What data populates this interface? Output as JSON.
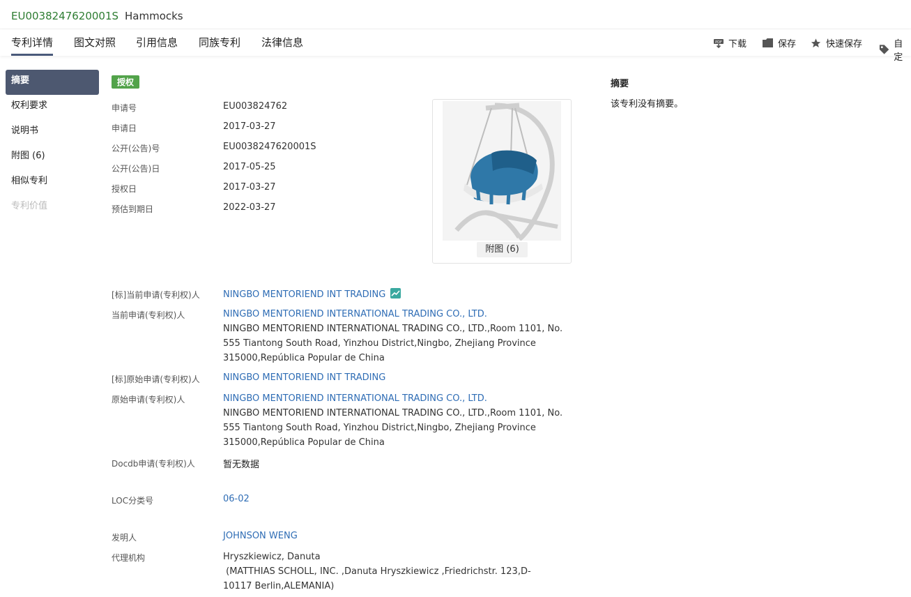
{
  "header": {
    "pub_number": "EU0038247620001S",
    "title": "Hammocks"
  },
  "tabs": [
    "专利详情",
    "图文对照",
    "引用信息",
    "同族专利",
    "法律信息"
  ],
  "toolbar": {
    "download": "下载",
    "save": "保存",
    "quick_save": "快速保存",
    "custom": "自定"
  },
  "sidebar": [
    "摘要",
    "权利要求",
    "说明书",
    "附图 (6)",
    "相似专利",
    "专利价值"
  ],
  "status_badge": "授权",
  "fields": {
    "app_no_label": "申请号",
    "app_no": "EU003824762",
    "app_date_label": "申请日",
    "app_date": "2017-03-27",
    "pub_no_label": "公开(公告)号",
    "pub_no": "EU0038247620001S",
    "pub_date_label": "公开(公告)日",
    "pub_date": "2017-05-25",
    "grant_date_label": "授权日",
    "grant_date": "2017-03-27",
    "expiry_label": "预估到期日",
    "expiry": "2022-03-27",
    "std_cur_app_label": "[标]当前申请(专利权)人",
    "std_cur_app": "NINGBO MENTORIEND INT TRADING",
    "cur_app_label": "当前申请(专利权)人",
    "cur_app": "NINGBO MENTORIEND INTERNATIONAL TRADING CO., LTD.",
    "cur_app_addr": "NINGBO MENTORIEND INTERNATIONAL TRADING CO., LTD.,Room 1101, No. 555 Tiantong South Road, Yinzhou District,Ningbo, Zhejiang Province 315000,República Popular de China",
    "std_orig_app_label": "[标]原始申请(专利权)人",
    "std_orig_app": "NINGBO MENTORIEND INT TRADING",
    "orig_app_label": "原始申请(专利权)人",
    "orig_app": "NINGBO MENTORIEND INTERNATIONAL TRADING CO., LTD.",
    "orig_app_addr": "NINGBO MENTORIEND INTERNATIONAL TRADING CO., LTD.,Room 1101, No. 555 Tiantong South Road, Yinzhou District,Ningbo, Zhejiang Province 315000,República Popular de China",
    "docdb_label": "Docdb申请(专利权)人",
    "docdb": "暂无数据",
    "loc_label": "LOC分类号",
    "loc": "06-02",
    "inventor_label": "发明人",
    "inventor": "JOHNSON WENG",
    "agency_label": "代理机构",
    "agency_name": "Hryszkiewicz, Danuta",
    "agency_detail": " (MATTHIAS SCHOLL, INC. ,Danuta Hryszkiewicz ,Friedrichstr. 123,D-10117 Berlin,ALEMANIA)"
  },
  "figure_button": "附图 (6)",
  "abstract": {
    "title": "摘要",
    "text": "该专利没有摘要。"
  },
  "colors": {
    "accent_green": "#2e7d32",
    "link": "#2f6db5",
    "nav_active": "#4d5870",
    "badge": "#52a34a"
  }
}
